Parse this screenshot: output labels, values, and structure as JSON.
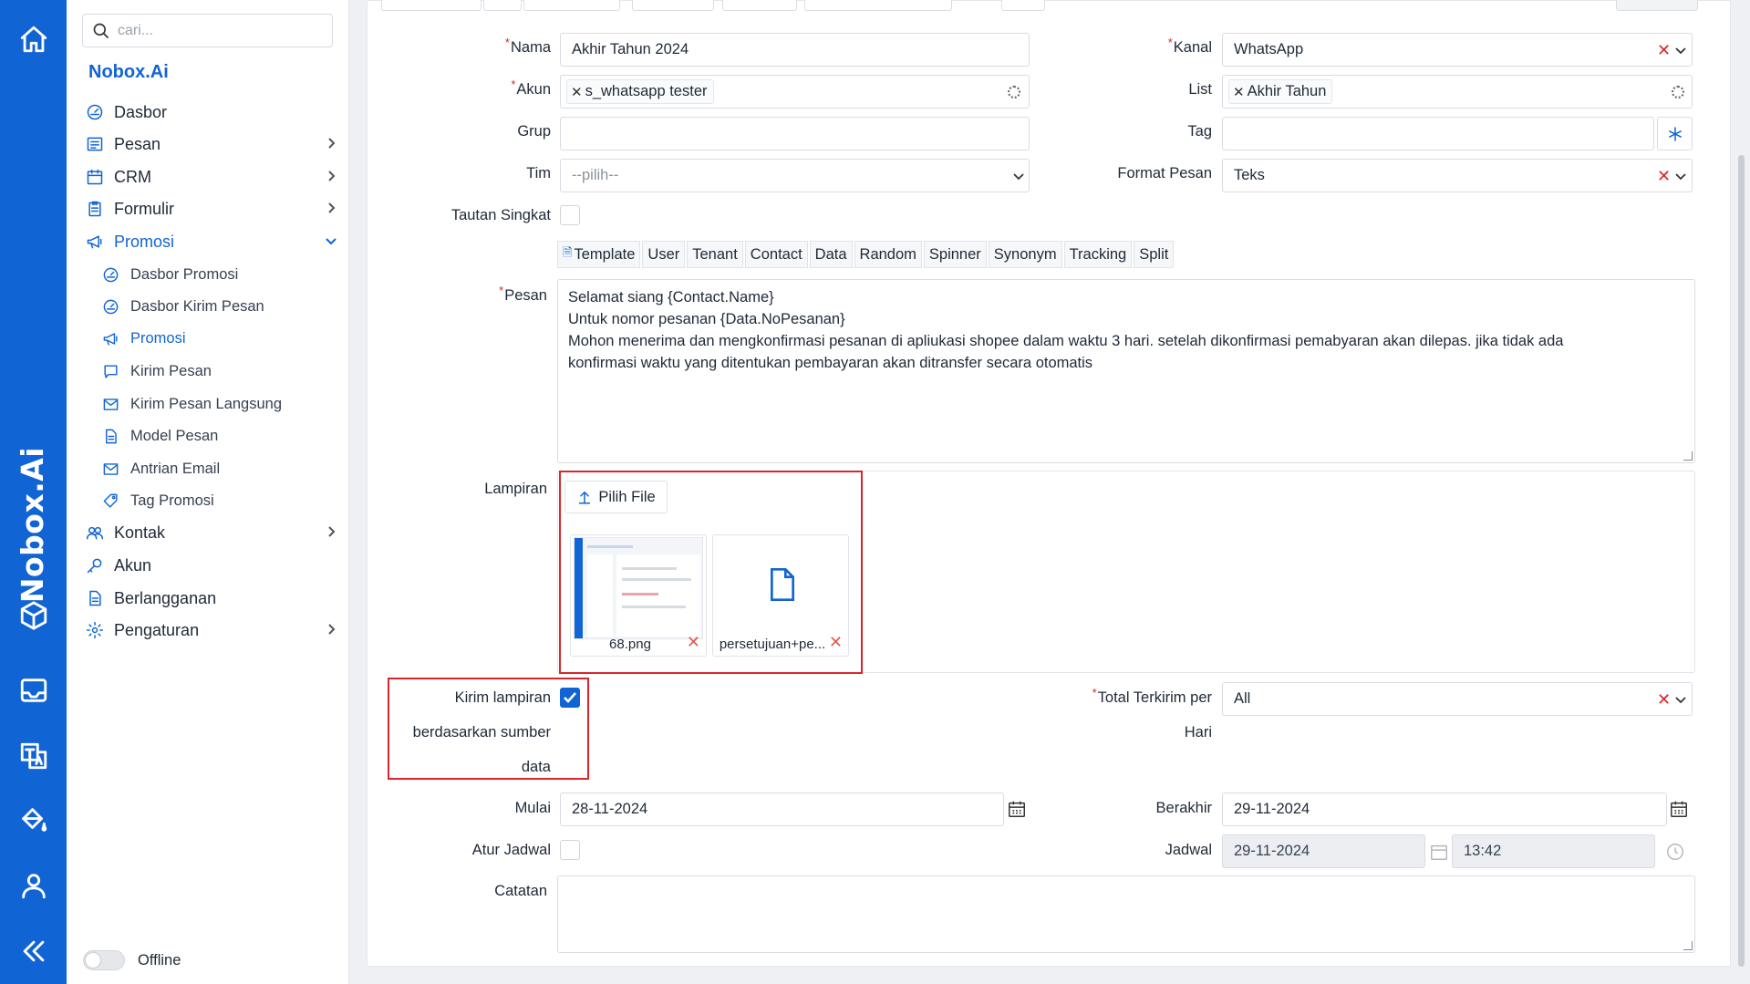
{
  "search": {
    "placeholder": "cari..."
  },
  "rail": {
    "brand": "Nobox.Ai"
  },
  "sidebar": {
    "brand": "Nobox.Ai",
    "items": [
      {
        "label": "Dasbor"
      },
      {
        "label": "Pesan"
      },
      {
        "label": "CRM"
      },
      {
        "label": "Formulir"
      },
      {
        "label": "Promosi"
      },
      {
        "label": "Kontak"
      },
      {
        "label": "Akun"
      },
      {
        "label": "Berlangganan"
      },
      {
        "label": "Pengaturan"
      }
    ],
    "sub_items": [
      {
        "label": "Dasbor Promosi"
      },
      {
        "label": "Dasbor Kirim Pesan"
      },
      {
        "label": "Promosi"
      },
      {
        "label": "Kirim Pesan"
      },
      {
        "label": "Kirim Pesan Langsung"
      },
      {
        "label": "Model Pesan"
      },
      {
        "label": "Antrian Email"
      },
      {
        "label": "Tag Promosi"
      }
    ],
    "offline_label": "Offline"
  },
  "form": {
    "nama": {
      "label": "Nama",
      "value": "Akhir Tahun 2024"
    },
    "kanal": {
      "label": "Kanal",
      "value": "WhatsApp"
    },
    "akun": {
      "label": "Akun",
      "chip": "s_whatsapp tester"
    },
    "list": {
      "label": "List",
      "chip": "Akhir Tahun"
    },
    "grup": {
      "label": "Grup",
      "value": ""
    },
    "tag": {
      "label": "Tag",
      "value": ""
    },
    "tim": {
      "label": "Tim",
      "placeholder": "--pilih--"
    },
    "format_pesan": {
      "label": "Format Pesan",
      "value": "Teks"
    },
    "tautan_singkat": {
      "label": "Tautan Singkat"
    },
    "toolbar": [
      "Template",
      "User",
      "Tenant",
      "Contact",
      "Data",
      "Random",
      "Spinner",
      "Synonym",
      "Tracking",
      "Split"
    ],
    "pesan": {
      "label": "Pesan",
      "lines": [
        "Selamat siang {Contact.Name}",
        "Untuk nomor pesanan {Data.NoPesanan}",
        "Mohon menerima dan mengkonfirmasi pesanan di apliukasi shopee dalam waktu 3 hari. setelah dikonfirmasi pemabyaran akan dilepas. jika tidak ada",
        "konfirmasi waktu yang ditentukan pembayaran akan ditransfer secara otomatis"
      ]
    },
    "lampiran": {
      "label": "Lampiran",
      "pick_label": "Pilih File",
      "files": [
        {
          "name": "68.png"
        },
        {
          "name": "persetujuan+pe..."
        }
      ]
    },
    "kirim_lampiran": {
      "line1": "Kirim lampiran",
      "line2": "berdasarkan sumber",
      "line3": "data",
      "checked": true
    },
    "total_terkirim": {
      "line1": "Total Terkirim per",
      "line2": "Hari",
      "value": "All"
    },
    "mulai": {
      "label": "Mulai",
      "value": "28-11-2024"
    },
    "berakhir": {
      "label": "Berakhir",
      "value": "29-11-2024"
    },
    "atur_jadwal": {
      "label": "Atur Jadwal"
    },
    "jadwal": {
      "label": "Jadwal",
      "date": "29-11-2024",
      "time": "13:42"
    },
    "catatan": {
      "label": "Catatan",
      "value": ""
    }
  },
  "colors": {
    "brand": "#1164d4",
    "required": "#e02424",
    "highlight": "#d9262c"
  }
}
